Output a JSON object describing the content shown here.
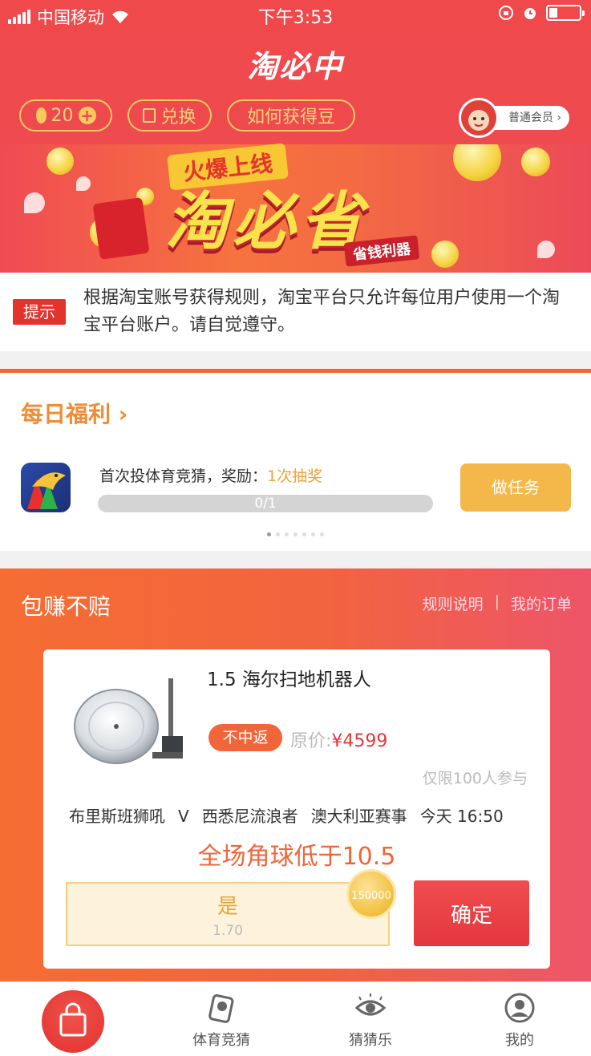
{
  "status_bar": {
    "carrier": "中国移动",
    "time": "下午3:53"
  },
  "app": {
    "title": "淘必中"
  },
  "header": {
    "bean_count": "20",
    "exchange_label": "兑换",
    "how_to_label": "如何获得豆",
    "member_label": "普通会员"
  },
  "banner": {
    "tag": "火爆上线",
    "title": "淘必省",
    "subtitle": "省钱利器"
  },
  "notice": {
    "tag": "提示",
    "text": "根据淘宝账号获得规则，淘宝平台只允许每位用户使用一个淘宝平台账户。请自觉遵守。"
  },
  "daily": {
    "title": "每日福利",
    "task_text": "首次投体育竞猜，奖励：",
    "task_reward": "1次抽奖",
    "progress_text": "0/1",
    "progress_fraction": 0,
    "button_label": "做任务"
  },
  "earn": {
    "title": "包赚不赔",
    "rules_link": "规则说明",
    "separator": "|",
    "orders_link": "我的订单",
    "card": {
      "product_name": "1.5 海尔扫地机器人",
      "no_win_tag": "不中返",
      "orig_label": "原价:",
      "orig_price": "¥4599",
      "limit_text": "仅限100人参与",
      "team_home": "布里斯班狮吼",
      "vs": "V",
      "team_away": "西悉尼流浪者",
      "league": "澳大利亚赛事",
      "match_time": "今天 16:50",
      "question": "全场角球低于10.5",
      "option_label": "是",
      "option_odds": "1.70",
      "stake": "150000",
      "confirm_label": "确定"
    }
  },
  "tabbar": {
    "tabs": [
      {
        "label": "体育竞猜",
        "icon": "ball-card-icon"
      },
      {
        "label": "猜猜乐",
        "icon": "eye-icon"
      },
      {
        "label": "我的",
        "icon": "user-icon"
      }
    ]
  },
  "colors": {
    "brand_red": "#ee4a4f",
    "orange": "#f26a2e",
    "gold": "#f4b74a"
  }
}
